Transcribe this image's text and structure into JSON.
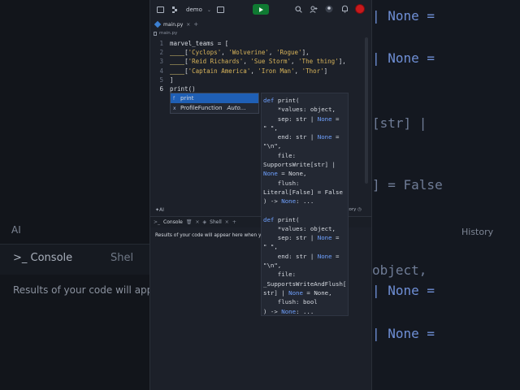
{
  "backdrop": {
    "ai_label": "AI",
    "console_label": "Console",
    "shell_label": "Shel",
    "results_text": "Results of your code will appe",
    "history_label": "History",
    "right_fragments": [
      {
        "text": "| None =",
        "blue": true
      },
      {
        "text": "| None =",
        "blue": true
      },
      {
        "text": "[str] |",
        "blue": false
      },
      {
        "text": "] = False",
        "blue": false
      },
      {
        "text": "object,",
        "blue": false
      },
      {
        "text": "| None =",
        "blue": true
      },
      {
        "text": "| None =",
        "blue": true
      },
      {
        "text": "| None =",
        "blue": true
      }
    ]
  },
  "topbar": {
    "repl_name": "demo",
    "chevron": "⌄",
    "run_color": "#0f7a32",
    "avatar_color": "#c8191c"
  },
  "filebar": {
    "file_name": "main.py",
    "close": "×",
    "add": "+"
  },
  "breadcrumb": {
    "file_name": "main.py"
  },
  "editor": {
    "line_numbers": [
      "1",
      "2",
      "3",
      "4",
      "5",
      "6"
    ],
    "lines": [
      [
        {
          "t": "marvel_teams = [",
          "c": ""
        }
      ],
      [
        {
          "t": "____",
          "c": "guide"
        },
        {
          "t": "[",
          "c": ""
        },
        {
          "t": "'Cyclops'",
          "c": "str"
        },
        {
          "t": ", ",
          "c": ""
        },
        {
          "t": "'Wolverine'",
          "c": "str"
        },
        {
          "t": ", ",
          "c": ""
        },
        {
          "t": "'Rogue'",
          "c": "str"
        },
        {
          "t": "],",
          "c": ""
        }
      ],
      [
        {
          "t": "____",
          "c": "guide"
        },
        {
          "t": "[",
          "c": ""
        },
        {
          "t": "'Reid Richards'",
          "c": "str"
        },
        {
          "t": ", ",
          "c": ""
        },
        {
          "t": "'Sue Storm'",
          "c": "str"
        },
        {
          "t": ", ",
          "c": ""
        },
        {
          "t": "'The thing'",
          "c": "str"
        },
        {
          "t": "],",
          "c": ""
        }
      ],
      [
        {
          "t": "____",
          "c": "guide"
        },
        {
          "t": "[",
          "c": ""
        },
        {
          "t": "'Captain America'",
          "c": "str"
        },
        {
          "t": ", ",
          "c": ""
        },
        {
          "t": "'Iron Man'",
          "c": "str"
        },
        {
          "t": ", ",
          "c": ""
        },
        {
          "t": "'Thor'",
          "c": "str"
        },
        {
          "t": "]",
          "c": ""
        }
      ],
      [
        {
          "t": "]",
          "c": ""
        }
      ],
      [
        {
          "t": "print()",
          "c": ""
        }
      ]
    ]
  },
  "autocomplete": {
    "items": [
      {
        "kind": "f",
        "label": "print",
        "detail": "",
        "selected": true
      },
      {
        "kind": "x",
        "label": "ProfileFunction",
        "detail": "Auto…",
        "selected": false
      }
    ]
  },
  "signature_help": {
    "lines": [
      [
        {
          "t": "def ",
          "k": true
        },
        {
          "t": "print(",
          "k": false
        }
      ],
      [
        {
          "t": "    *values: object,",
          "k": false
        }
      ],
      [
        {
          "t": "    sep: str | ",
          "k": false
        },
        {
          "t": "None",
          "k": true
        },
        {
          "t": " =",
          "k": false
        }
      ],
      [
        {
          "t": "\" \",",
          "k": false
        }
      ],
      [
        {
          "t": "    end: str | ",
          "k": false
        },
        {
          "t": "None",
          "k": true
        },
        {
          "t": " =",
          "k": false
        }
      ],
      [
        {
          "t": "\"\\n\",",
          "k": false
        }
      ],
      [
        {
          "t": "    file:",
          "k": false
        }
      ],
      [
        {
          "t": "SupportsWrite[str] |",
          "k": false
        }
      ],
      [
        {
          "t": "None",
          "k": true
        },
        {
          "t": " = None,",
          "k": false
        }
      ],
      [
        {
          "t": "    flush:",
          "k": false
        }
      ],
      [
        {
          "t": "Literal[False] = False",
          "k": false
        }
      ],
      [
        {
          "t": ") -> ",
          "k": false
        },
        {
          "t": "None",
          "k": true
        },
        {
          "t": ": ...",
          "k": false
        }
      ],
      [],
      [
        {
          "t": "def ",
          "k": true
        },
        {
          "t": "print(",
          "k": false
        }
      ],
      [
        {
          "t": "    *values: object,",
          "k": false
        }
      ],
      [
        {
          "t": "    sep: str | ",
          "k": false
        },
        {
          "t": "None",
          "k": true
        },
        {
          "t": " =",
          "k": false
        }
      ],
      [
        {
          "t": "\" \",",
          "k": false
        }
      ],
      [
        {
          "t": "    end: str | ",
          "k": false
        },
        {
          "t": "None",
          "k": true
        },
        {
          "t": " =",
          "k": false
        }
      ],
      [
        {
          "t": "\"\\n\",",
          "k": false
        }
      ],
      [
        {
          "t": "    file:",
          "k": false
        }
      ],
      [
        {
          "t": "_SupportsWriteAndFlush[",
          "k": false
        }
      ],
      [
        {
          "t": "str] | ",
          "k": false
        },
        {
          "t": "None",
          "k": true
        },
        {
          "t": " = None,",
          "k": false
        }
      ],
      [
        {
          "t": "    flush: bool",
          "k": false
        }
      ],
      [
        {
          "t": ") -> ",
          "k": false
        },
        {
          "t": "None",
          "k": true
        },
        {
          "t": ": ...",
          "k": false
        }
      ]
    ]
  },
  "midbar": {
    "ai_label": "AI",
    "history_label": "History"
  },
  "console": {
    "tab_label": "Console",
    "shell_label": "Shell",
    "add": "+",
    "close": "×",
    "message": "Results of your code will appear here when you"
  }
}
